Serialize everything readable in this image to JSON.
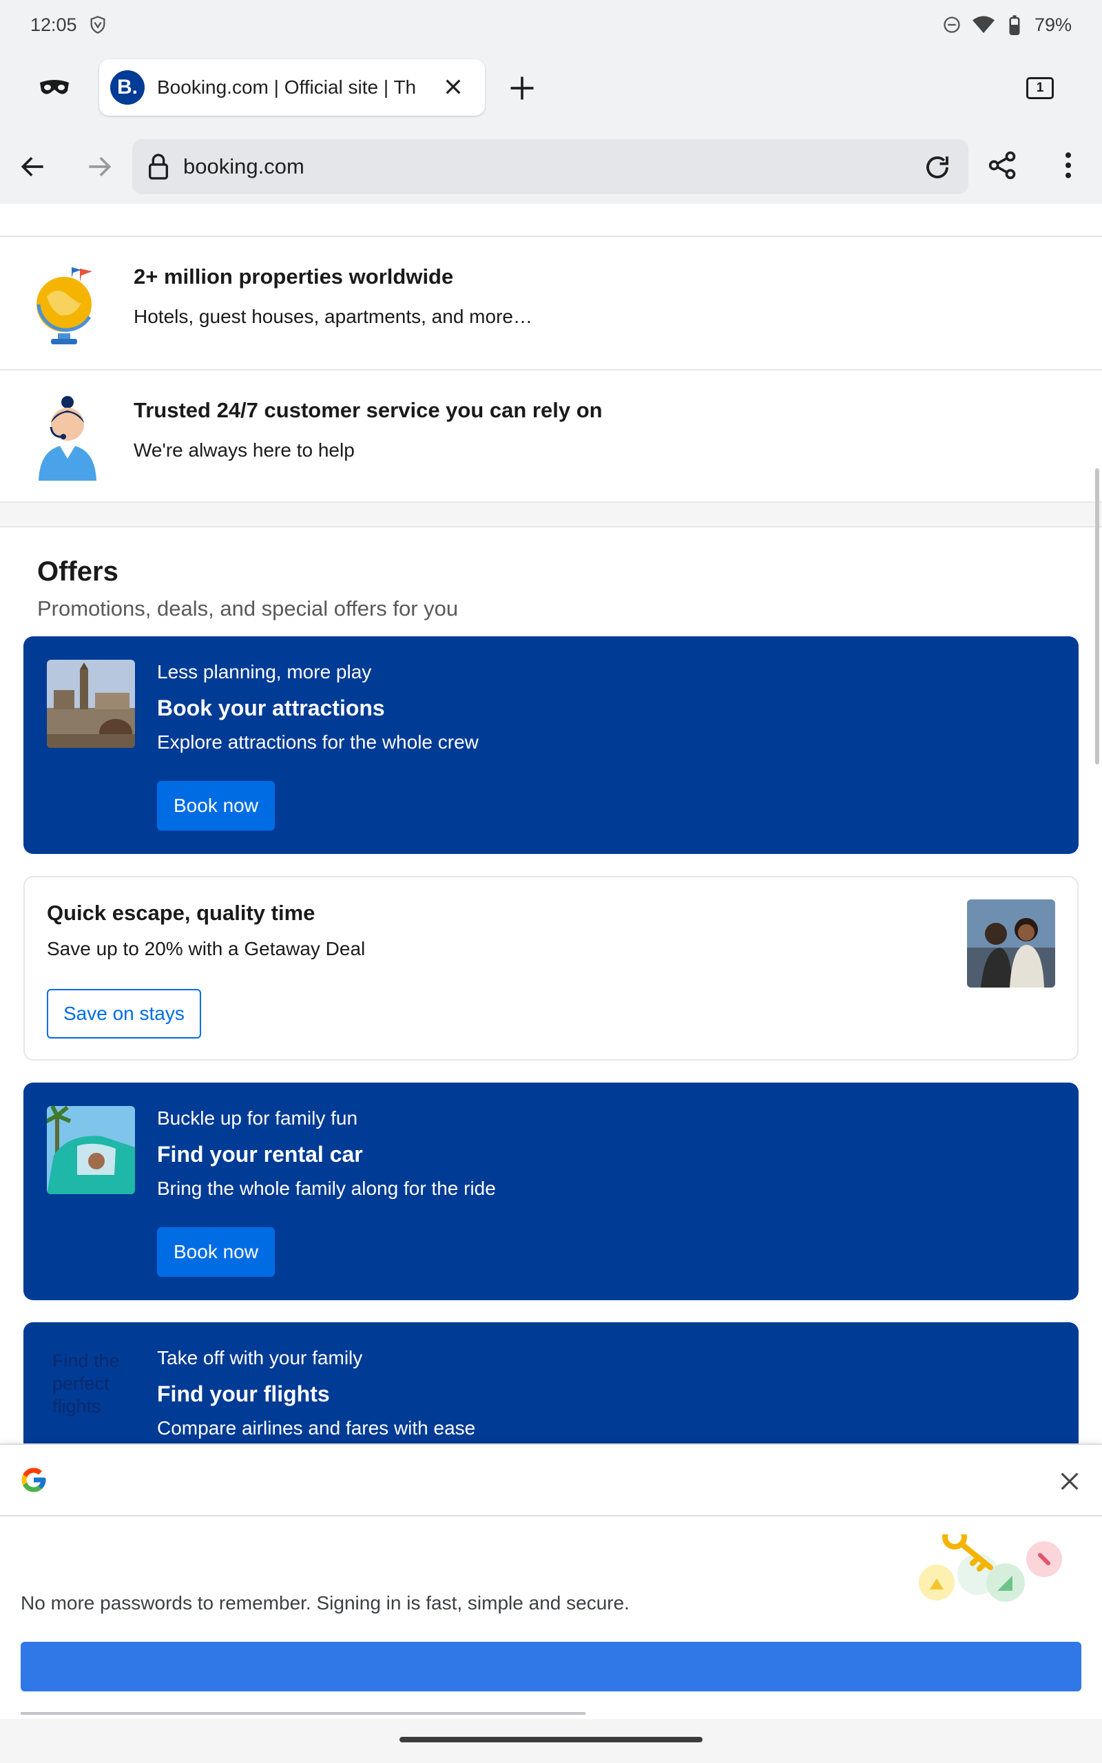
{
  "status_bar": {
    "time": "12:05",
    "battery": "79%"
  },
  "browser": {
    "tab": {
      "favicon_letter": "B.",
      "title": "Booking.com | Official site | Th"
    },
    "tab_count": "1",
    "url": "booking.com"
  },
  "features": [
    {
      "title": "2+ million properties worldwide",
      "subtitle": "Hotels, guest houses, apartments, and more…"
    },
    {
      "title": "Trusted 24/7 customer service you can rely on",
      "subtitle": "We're always here to help"
    }
  ],
  "offers": {
    "heading": "Offers",
    "subheading": "Promotions, deals, and special offers for you",
    "attractions": {
      "eyebrow": "Less planning, more play",
      "title": "Book your attractions",
      "description": "Explore attractions for the whole crew",
      "button": "Book now"
    },
    "getaway": {
      "title": "Quick escape, quality time",
      "description": "Save up to 20% with a Getaway Deal",
      "button": "Save on stays"
    },
    "rental_car": {
      "eyebrow": "Buckle up for family fun",
      "title": "Find your rental car",
      "description": "Bring the whole family along for the ride",
      "button": "Book now"
    },
    "flights": {
      "image_alt": "Find the perfect flights",
      "eyebrow": "Take off with your family",
      "title": "Find your flights",
      "description": "Compare airlines and fares with ease"
    }
  },
  "google_sheet": {
    "message": "No more passwords to remember. Signing in is fast, simple and secure."
  },
  "colors": {
    "brand_blue": "#003b95",
    "button_blue": "#006ce4",
    "google_blue": "#3077e8"
  }
}
